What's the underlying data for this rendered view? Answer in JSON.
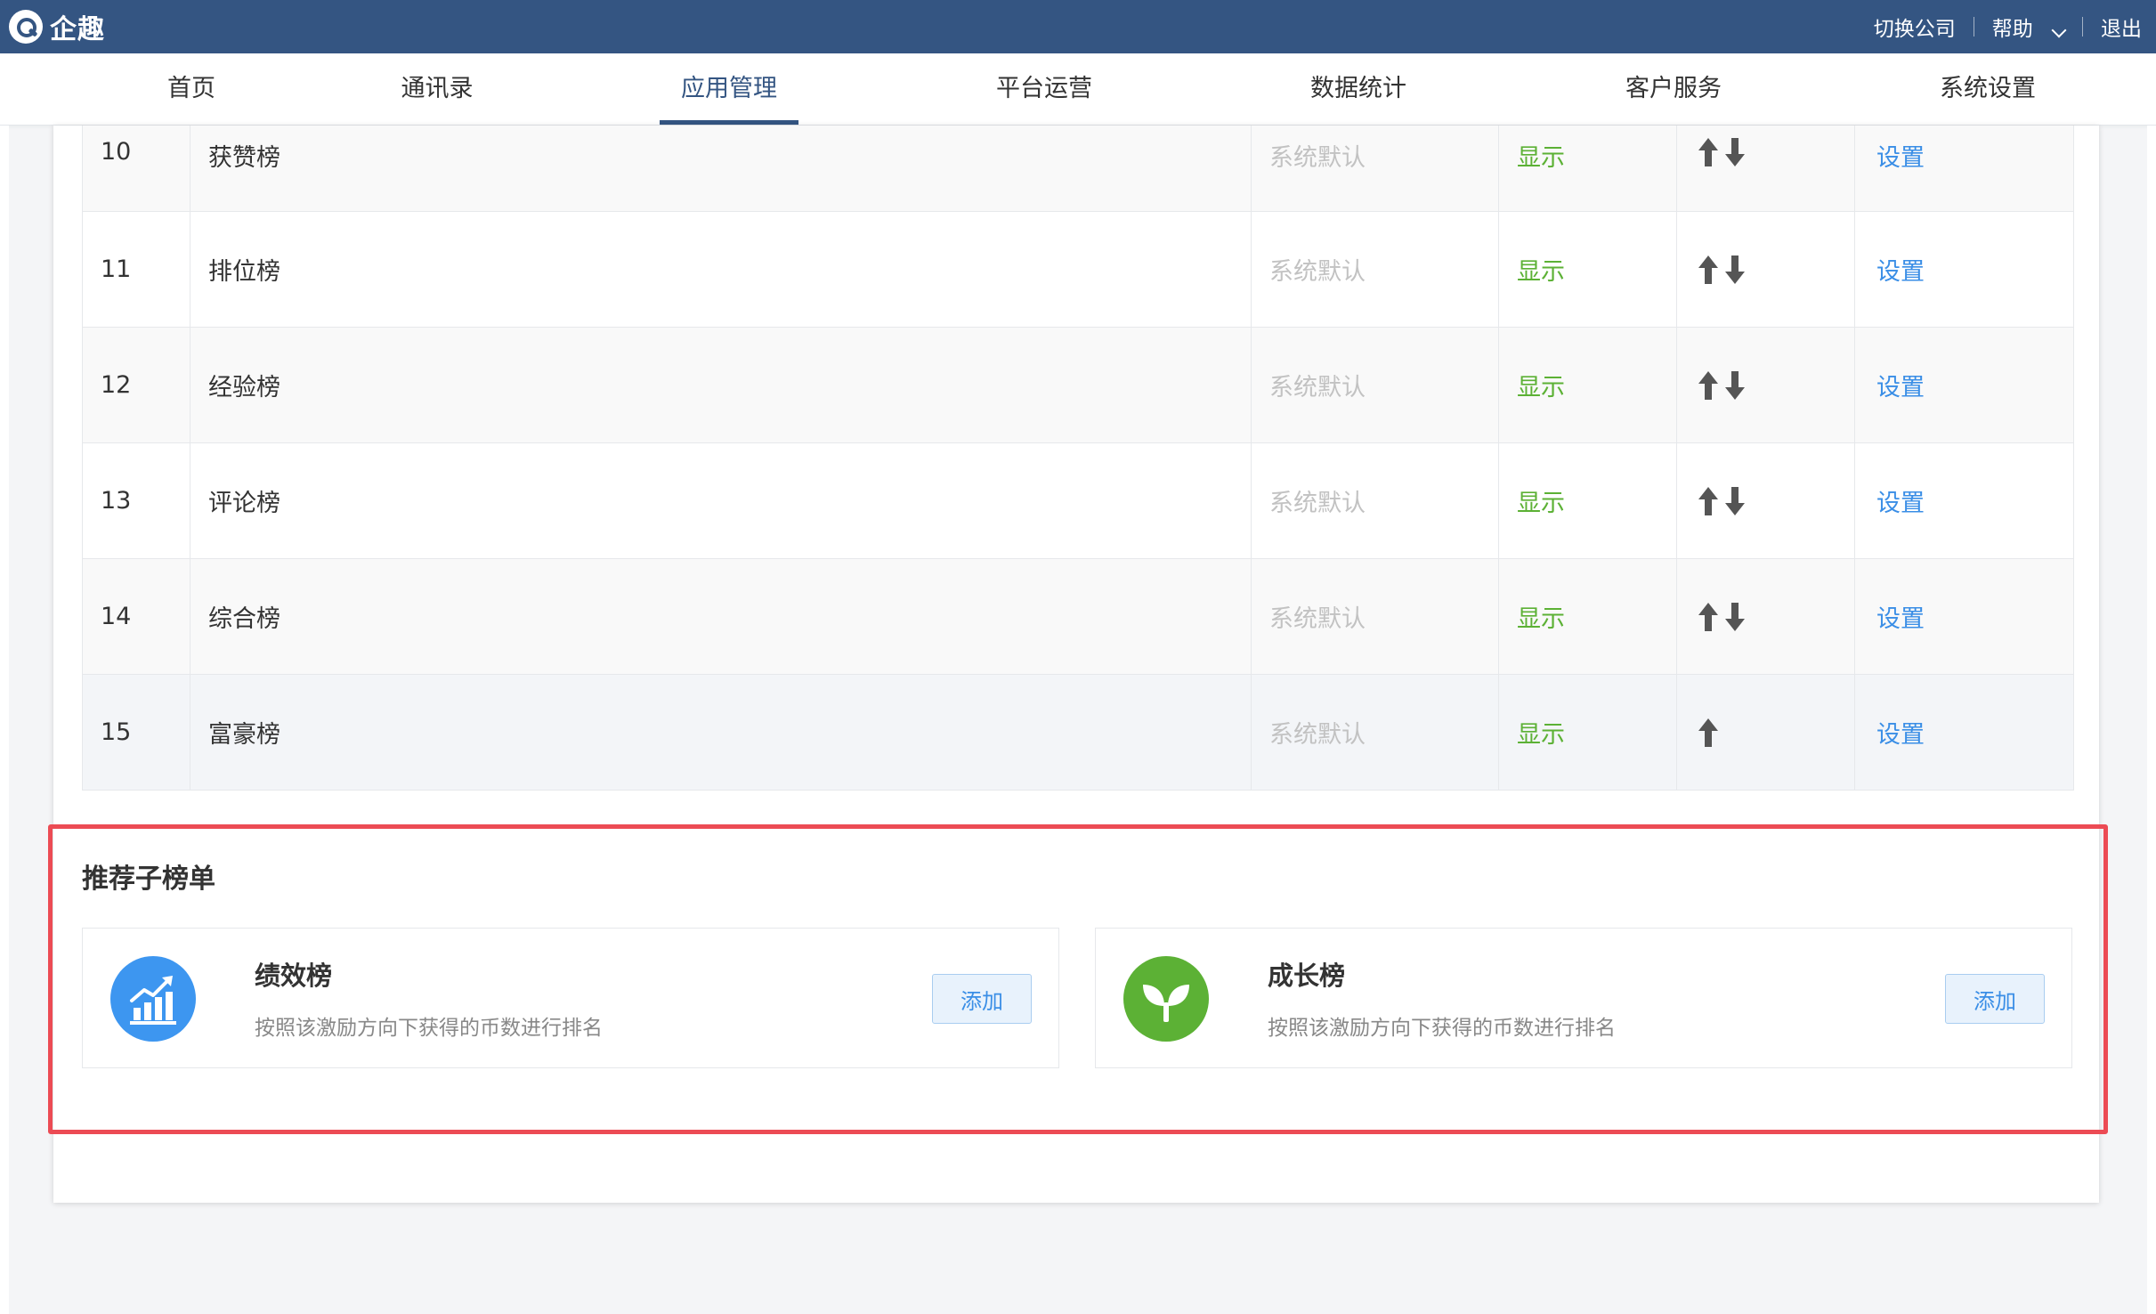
{
  "topbar": {
    "brand": "企趣",
    "switch_company": "切换公司",
    "help": "帮助",
    "logout": "退出"
  },
  "nav": {
    "items": [
      {
        "label": "首页"
      },
      {
        "label": "通讯录"
      },
      {
        "label": "应用管理"
      },
      {
        "label": "平台运营"
      },
      {
        "label": "数据统计"
      },
      {
        "label": "客户服务"
      },
      {
        "label": "系统设置"
      }
    ],
    "active": "应用管理"
  },
  "table": {
    "rows": [
      {
        "index": "10",
        "name": "获赞榜",
        "type": "系统默认",
        "status": "显示",
        "sort": [
          "up",
          "down"
        ],
        "action": "设置"
      },
      {
        "index": "11",
        "name": "排位榜",
        "type": "系统默认",
        "status": "显示",
        "sort": [
          "up",
          "down"
        ],
        "action": "设置"
      },
      {
        "index": "12",
        "name": "经验榜",
        "type": "系统默认",
        "status": "显示",
        "sort": [
          "up",
          "down"
        ],
        "action": "设置"
      },
      {
        "index": "13",
        "name": "评论榜",
        "type": "系统默认",
        "status": "显示",
        "sort": [
          "up",
          "down"
        ],
        "action": "设置"
      },
      {
        "index": "14",
        "name": "综合榜",
        "type": "系统默认",
        "status": "显示",
        "sort": [
          "up",
          "down"
        ],
        "action": "设置"
      },
      {
        "index": "15",
        "name": "富豪榜",
        "type": "系统默认",
        "status": "显示",
        "sort": [
          "up"
        ],
        "action": "设置"
      }
    ]
  },
  "recommend": {
    "title": "推荐子榜单",
    "cards": [
      {
        "title": "绩效榜",
        "desc": "按照该激励方向下获得的币数进行排名",
        "button": "添加",
        "icon": "chart-growth-icon",
        "color": "#3d96f0"
      },
      {
        "title": "成长榜",
        "desc": "按照该激励方向下获得的币数进行排名",
        "button": "添加",
        "icon": "sprout-icon",
        "color": "#5cb135"
      }
    ]
  },
  "colors": {
    "header": "#345582",
    "status_green": "#5cb135",
    "link_blue": "#3a8ee6",
    "highlight_red": "#ec4b54"
  }
}
